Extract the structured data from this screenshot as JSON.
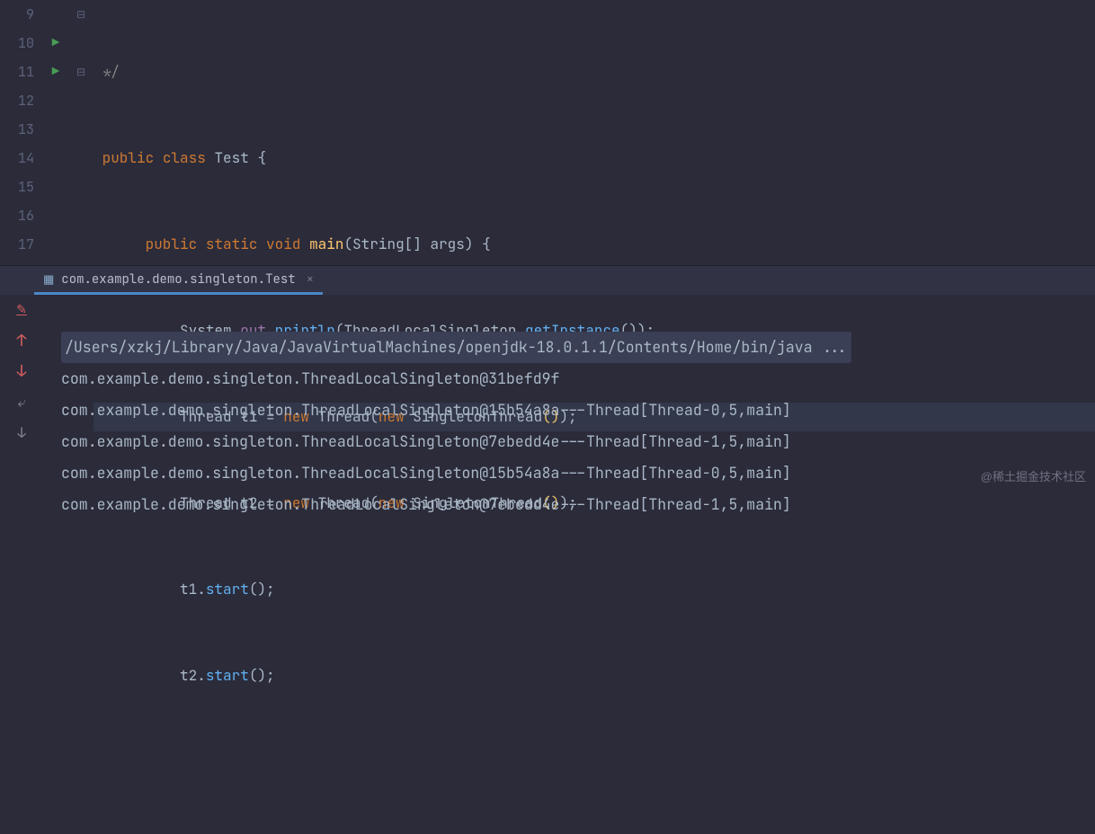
{
  "gutter": [
    "9",
    "10",
    "11",
    "12",
    "13",
    "14",
    "15",
    "16",
    "17"
  ],
  "run_markers": {
    "1": true,
    "2": true
  },
  "fold_markers": {
    "0": "⊟",
    "2": "⊟"
  },
  "code": {
    "l0": {
      "cmt": "*/"
    },
    "l1": {
      "k1": "public",
      "k2": "class",
      "cls": "Test",
      "b": "{"
    },
    "l2": {
      "k1": "public",
      "k2": "static",
      "k3": "void",
      "fn": "main",
      "p1": "(String[] args)",
      "b": " {"
    },
    "l3": {
      "a": "System.",
      "b": "out",
      "c": ".",
      "d": "println",
      "e": "(ThreadLocalSingleton.",
      "f": "getInstance",
      "g": "());"
    },
    "l4": {
      "a": "Thread t1 = ",
      "k": "new",
      "b": " Thread(",
      "k2": "new",
      "c": " SingletonThread",
      "d": "()",
      "e": ");"
    },
    "l5": {
      "a": "Thread t2 = ",
      "k": "new",
      "b": " Thread(",
      "k2": "new",
      "c": " SingletonThread",
      "d": "()",
      "e": ");"
    },
    "l6": {
      "a": "t1.",
      "m": "start",
      "b": "();"
    },
    "l7": {
      "a": "t2.",
      "m": "start",
      "b": "();"
    },
    "l8": {
      "blank": " "
    }
  },
  "tab": {
    "label": "com.example.demo.singleton.Test"
  },
  "console": {
    "cmd": "/Users/xzkj/Library/Java/JavaVirtualMachines/openjdk-18.0.1.1/Contents/Home/bin/java ...",
    "lines": [
      "com.example.demo.singleton.ThreadLocalSingleton@31befd9f",
      "com.example.demo.singleton.ThreadLocalSingleton@15b54a8a---Thread[Thread-0,5,main]",
      "com.example.demo.singleton.ThreadLocalSingleton@7ebedd4e---Thread[Thread-1,5,main]",
      "com.example.demo.singleton.ThreadLocalSingleton@15b54a8a---Thread[Thread-0,5,main]",
      "com.example.demo.singleton.ThreadLocalSingleton@7ebedd4e---Thread[Thread-1,5,main]"
    ]
  },
  "watermark": "@稀土掘金技术社区"
}
